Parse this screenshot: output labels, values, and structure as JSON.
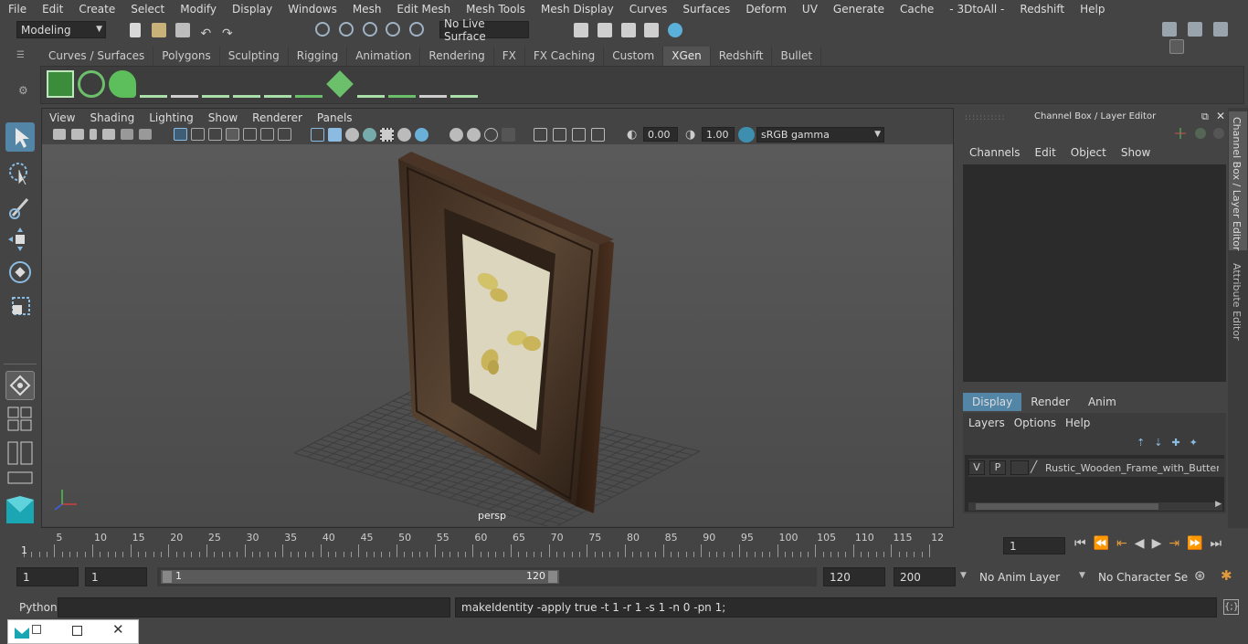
{
  "menu": [
    "File",
    "Edit",
    "Create",
    "Select",
    "Modify",
    "Display",
    "Windows",
    "Mesh",
    "Edit Mesh",
    "Mesh Tools",
    "Mesh Display",
    "Curves",
    "Surfaces",
    "Deform",
    "UV",
    "Generate",
    "Cache",
    "- 3DtoAll -",
    "Redshift",
    "Help"
  ],
  "status": {
    "mode": "Modeling",
    "live_surface": "No Live Surface"
  },
  "shelf_tabs": [
    "Curves / Surfaces",
    "Polygons",
    "Sculpting",
    "Rigging",
    "Animation",
    "Rendering",
    "FX",
    "FX Caching",
    "Custom",
    "XGen",
    "Redshift",
    "Bullet"
  ],
  "shelf_active": "XGen",
  "panel_menu": [
    "View",
    "Shading",
    "Lighting",
    "Show",
    "Renderer",
    "Panels"
  ],
  "viewport": {
    "exposure": "0.00",
    "gamma": "1.00",
    "color_space": "sRGB gamma",
    "camera_label": "persp"
  },
  "channel_box": {
    "title": "Channel Box / Layer Editor",
    "menu": [
      "Channels",
      "Edit",
      "Object",
      "Show"
    ],
    "layer_tabs": [
      "Display",
      "Render",
      "Anim"
    ],
    "layer_tab_active": "Display",
    "layer_menu": [
      "Layers",
      "Options",
      "Help"
    ],
    "layer": {
      "v": "V",
      "p": "P",
      "name": "Rustic_Wooden_Frame_with_Butterfl"
    }
  },
  "side_tabs": [
    "Channel Box / Layer Editor",
    "Attribute Editor"
  ],
  "timeline": {
    "ticks": [
      "5",
      "10",
      "15",
      "20",
      "25",
      "30",
      "35",
      "40",
      "45",
      "50",
      "55",
      "60",
      "65",
      "70",
      "75",
      "80",
      "85",
      "90",
      "95",
      "100",
      "105",
      "110",
      "115",
      "12"
    ],
    "start_marker": "1",
    "current_frame": "1"
  },
  "range": {
    "start": "1",
    "start2": "1",
    "slider_start": "1",
    "slider_end": "120",
    "end": "120",
    "max": "200",
    "anim_layer": "No Anim Layer",
    "char_set": "No Character Set"
  },
  "cmd": {
    "lang": "Python",
    "feedback": "makeIdentity -apply true -t 1 -r 1 -s 1 -n 0 -pn 1;"
  },
  "colors": {
    "accent": "#5285a6",
    "bg": "#444444",
    "field": "#2b2b2b",
    "timeline_marker": "#e09a3c"
  }
}
